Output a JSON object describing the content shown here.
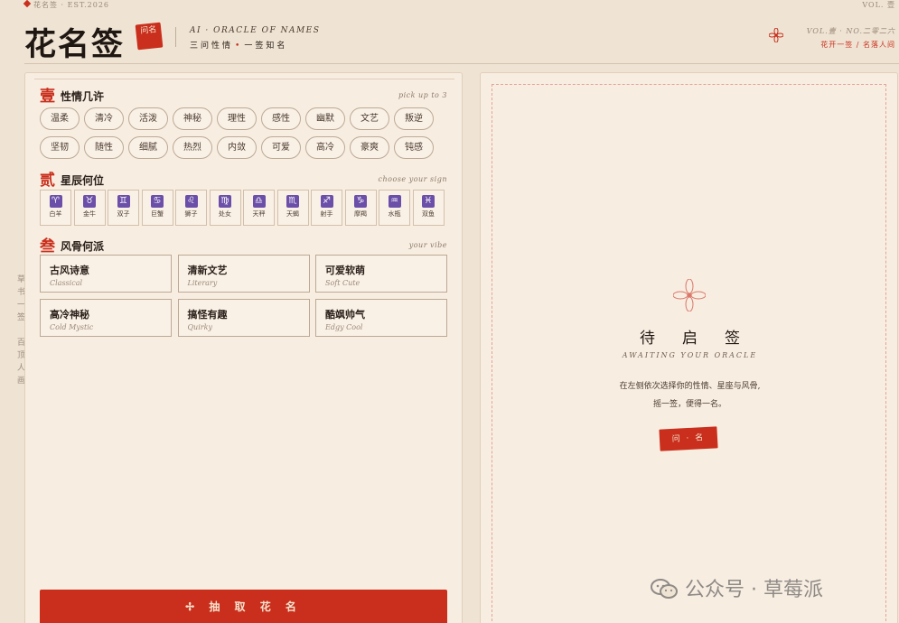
{
  "top_strip": {
    "left": "花名签 · EST.2026",
    "right": "VOL. 壹"
  },
  "header": {
    "brand": "花名签",
    "seal_text": "问名",
    "subtitle_en": "AI · ORACLE OF NAMES",
    "subtitle_cn_a": "三问性情",
    "subtitle_cn_b": "一签知名",
    "vol": "VOL.壹 · NO.二零二六",
    "motto": "花开一签 / 名落人间"
  },
  "side_letters": [
    "草",
    "书",
    "一",
    "签",
    "",
    "百",
    "顶",
    "人",
    "画"
  ],
  "sections": {
    "temperament": {
      "num": "壹",
      "title": "性情几许",
      "hint": "pick up to 3",
      "tags": [
        "温柔",
        "清冷",
        "活泼",
        "神秘",
        "理性",
        "感性",
        "幽默",
        "文艺",
        "叛逆",
        "坚韧",
        "随性",
        "细腻",
        "热烈",
        "内敛",
        "可爱",
        "高冷",
        "豪爽",
        "钝感"
      ]
    },
    "zodiac": {
      "num": "贰",
      "title": "星辰何位",
      "hint": "choose your sign",
      "signs": [
        {
          "symbol": "♈",
          "name": "白羊"
        },
        {
          "symbol": "♉",
          "name": "金牛"
        },
        {
          "symbol": "♊",
          "name": "双子"
        },
        {
          "symbol": "♋",
          "name": "巨蟹"
        },
        {
          "symbol": "♌",
          "name": "狮子"
        },
        {
          "symbol": "♍",
          "name": "处女"
        },
        {
          "symbol": "♎",
          "name": "天秤"
        },
        {
          "symbol": "♏",
          "name": "天蝎"
        },
        {
          "symbol": "♐",
          "name": "射手"
        },
        {
          "symbol": "♑",
          "name": "摩羯"
        },
        {
          "symbol": "♒",
          "name": "水瓶"
        },
        {
          "symbol": "♓",
          "name": "双鱼"
        }
      ]
    },
    "vibe": {
      "num": "叁",
      "title": "风骨何派",
      "hint": "your vibe",
      "options": [
        {
          "cn": "古风诗意",
          "en": "Classical"
        },
        {
          "cn": "清新文艺",
          "en": "Literary"
        },
        {
          "cn": "可爱软萌",
          "en": "Soft Cute"
        },
        {
          "cn": "高冷神秘",
          "en": "Cold Mystic"
        },
        {
          "cn": "搞怪有趣",
          "en": "Quirky"
        },
        {
          "cn": "酷飒帅气",
          "en": "Edgy Cool"
        }
      ]
    }
  },
  "draw_button": "✢ 抽 取 花 名",
  "result": {
    "title": "待启签",
    "subtitle": "AWAITING YOUR ORACLE",
    "desc_line1": "在左侧依次选择你的性情、星座与风骨,",
    "desc_line2": "摇一签，便得一名。",
    "ask_button": "问 · 名"
  },
  "watermark": "公众号 · 草莓派",
  "colors": {
    "accent_red": "#c92f1c",
    "paper": "#f8ede1",
    "background": "#efe3d3",
    "zodiac_purple": "#6b4fa8"
  }
}
